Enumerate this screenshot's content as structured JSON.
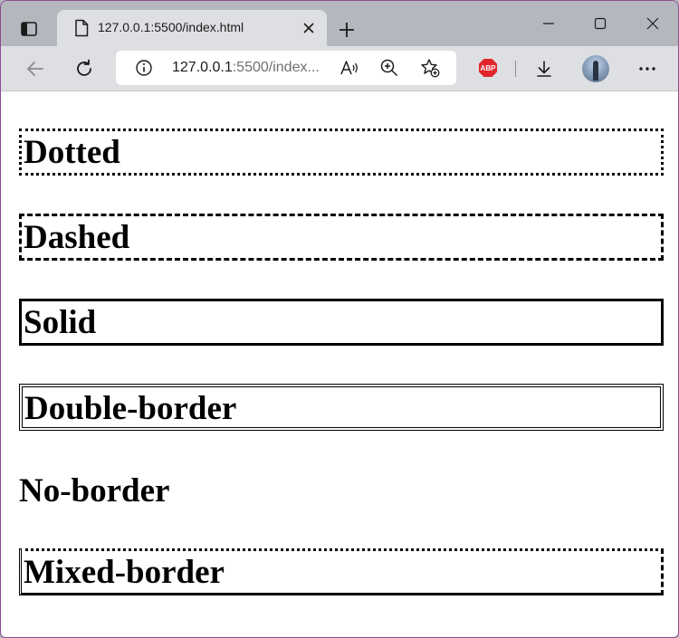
{
  "browser": {
    "tab": {
      "title": "127.0.0.1:5500/index.html"
    },
    "address_bar": {
      "host": "127.0.0.1",
      "rest": ":5500/index..."
    },
    "icons": {
      "workspaces": "tab-actions-icon",
      "back": "back-arrow-icon",
      "refresh": "refresh-icon",
      "site_info": "info-icon",
      "read_aloud": "read-aloud-icon",
      "zoom": "zoom-in-icon",
      "favorites": "add-favorite-icon",
      "adblock": "adblock-plus-icon",
      "downloads": "download-icon",
      "profile": "profile-avatar",
      "more": "more-icon"
    },
    "adblock_label": "ABP",
    "colors": {
      "adblock": "#e0262a",
      "window_border": "#8a4a92"
    }
  },
  "page": {
    "headings": [
      {
        "text": "Dotted",
        "border": "dotted"
      },
      {
        "text": "Dashed",
        "border": "dashed"
      },
      {
        "text": "Solid",
        "border": "solid"
      },
      {
        "text": "Double-border",
        "border": "double"
      },
      {
        "text": "No-border",
        "border": "none"
      },
      {
        "text": "Mixed-border",
        "border": "mixed"
      }
    ]
  }
}
